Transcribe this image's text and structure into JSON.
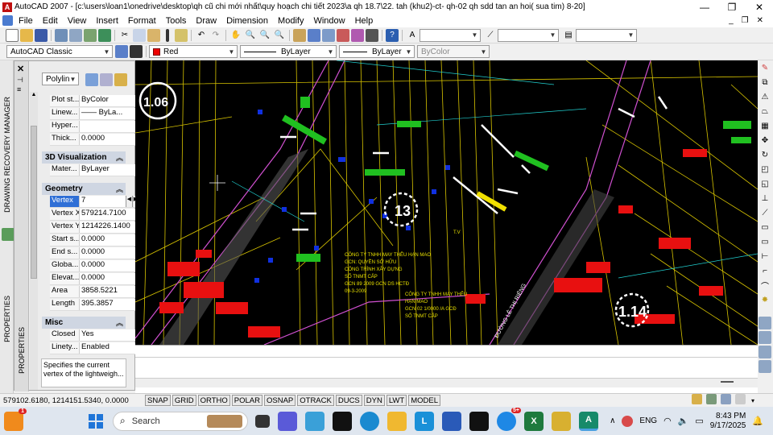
{
  "window": {
    "title": "AutoCAD 2007 - [c:\\users\\loan1\\onedrive\\desktop\\qh cũ chi mới nhất\\quy hoạch chi tiết 2023\\a qh 18.7\\22. tah (khu2)-ct- qh-02 qh sdd tan an hoi( sua tim) 8-20]",
    "minimize": "—",
    "restore": "❐",
    "close": "✕"
  },
  "menu": {
    "items": [
      "File",
      "Edit",
      "View",
      "Insert",
      "Format",
      "Tools",
      "Draw",
      "Dimension",
      "Modify",
      "Window",
      "Help"
    ],
    "mdi_min": "_",
    "mdi_restore": "❐",
    "mdi_close": "✕"
  },
  "toolbar2": {
    "workspace": "AutoCAD Classic",
    "color": "Red",
    "linetype": "ByLayer",
    "lineweight": "ByLayer",
    "plotstyle": "ByColor"
  },
  "properties": {
    "object_type": "Polylin",
    "general_rows": [
      {
        "k": "Plot st...",
        "v": "ByColor"
      },
      {
        "k": "Linew...",
        "v": "—— ByLa..."
      },
      {
        "k": "Hyper...",
        "v": ""
      },
      {
        "k": "Thick...",
        "v": "0.0000"
      }
    ],
    "sections": {
      "viz": "3D Visualization",
      "geometry": "Geometry",
      "misc": "Misc"
    },
    "viz_rows": [
      {
        "k": "Mater...",
        "v": "ByLayer"
      }
    ],
    "geometry_rows": [
      {
        "k": "Vertex",
        "v": "7"
      },
      {
        "k": "Vertex X",
        "v": "579214.7100"
      },
      {
        "k": "Vertex Y",
        "v": "1214226.1400"
      },
      {
        "k": "Start s...",
        "v": "0.0000"
      },
      {
        "k": "End s...",
        "v": "0.0000"
      },
      {
        "k": "Globa...",
        "v": "0.0000"
      },
      {
        "k": "Elevat...",
        "v": "0.0000"
      },
      {
        "k": "Area",
        "v": "3858.5221"
      },
      {
        "k": "Length",
        "v": "395.3857"
      }
    ],
    "misc_rows": [
      {
        "k": "Closed",
        "v": "Yes"
      },
      {
        "k": "Linety...",
        "v": "Enabled"
      }
    ],
    "help_text": "Specifies the current vertex of the lightweigh...",
    "strip_label": "PROPERTIES"
  },
  "left_panel": {
    "drm_label": "DRAWING RECOVERY MANAGER",
    "props_label": "PROPERTIES"
  },
  "drawing": {
    "labels": [
      "1.06",
      "13",
      "1.14"
    ],
    "texts": [
      "CÔNG TY TNHH MAY THÊU HẠN MAO",
      "GCN: QUYỀN SỞ HỮU",
      "CÔNG TRÌNH XÂY DỰNG",
      "SỐ TNMT CẤP",
      "GCN 89 2009 GCN DS HCTĐ",
      "09-3-2009",
      "CÔNG TY TNHH MAY THÊU",
      "HẠN MAO",
      "GCN 02 1/0000 /A GCĐ",
      "SỐ TNMT CẤP",
      "ĐƯỜNG LÊ THỊ RIÊNG",
      "T.V"
    ]
  },
  "status": {
    "coords": "579102.6180, 1214151.5340, 0.0000",
    "buttons": [
      "SNAP",
      "GRID",
      "ORTHO",
      "POLAR",
      "OSNAP",
      "OTRACK",
      "DUCS",
      "DYN",
      "LWT",
      "MODEL"
    ]
  },
  "taskbar": {
    "search": "Search",
    "lang": "ENG",
    "time": "8:43 PM",
    "date": "9/17/2025",
    "badge": "1",
    "zalo_badge": "5+"
  }
}
